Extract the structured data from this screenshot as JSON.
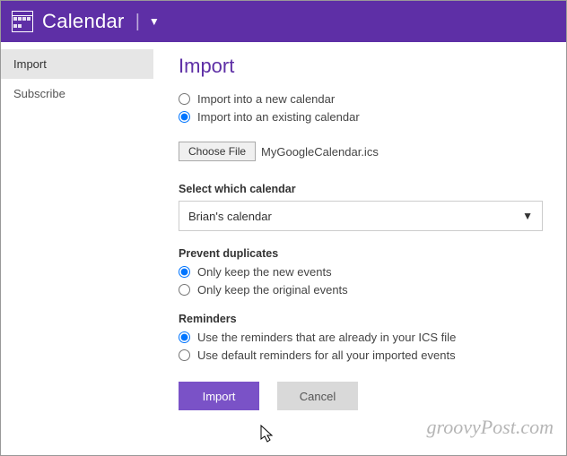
{
  "header": {
    "title": "Calendar"
  },
  "sidebar": {
    "items": [
      {
        "label": "Import",
        "active": true
      },
      {
        "label": "Subscribe",
        "active": false
      }
    ]
  },
  "main": {
    "heading": "Import",
    "importMode": {
      "options": [
        "Import into a new calendar",
        "Import into an existing calendar"
      ],
      "selectedIndex": 1
    },
    "file": {
      "buttonLabel": "Choose File",
      "fileName": "MyGoogleCalendar.ics"
    },
    "selectCalendar": {
      "label": "Select which calendar",
      "value": "Brian's calendar"
    },
    "preventDuplicates": {
      "label": "Prevent duplicates",
      "options": [
        "Only keep the new events",
        "Only keep the original events"
      ],
      "selectedIndex": 0
    },
    "reminders": {
      "label": "Reminders",
      "options": [
        "Use the reminders that are already in your ICS file",
        "Use default reminders for all your imported events"
      ],
      "selectedIndex": 0
    },
    "buttons": {
      "primary": "Import",
      "secondary": "Cancel"
    }
  },
  "watermark": "groovyPost.com"
}
